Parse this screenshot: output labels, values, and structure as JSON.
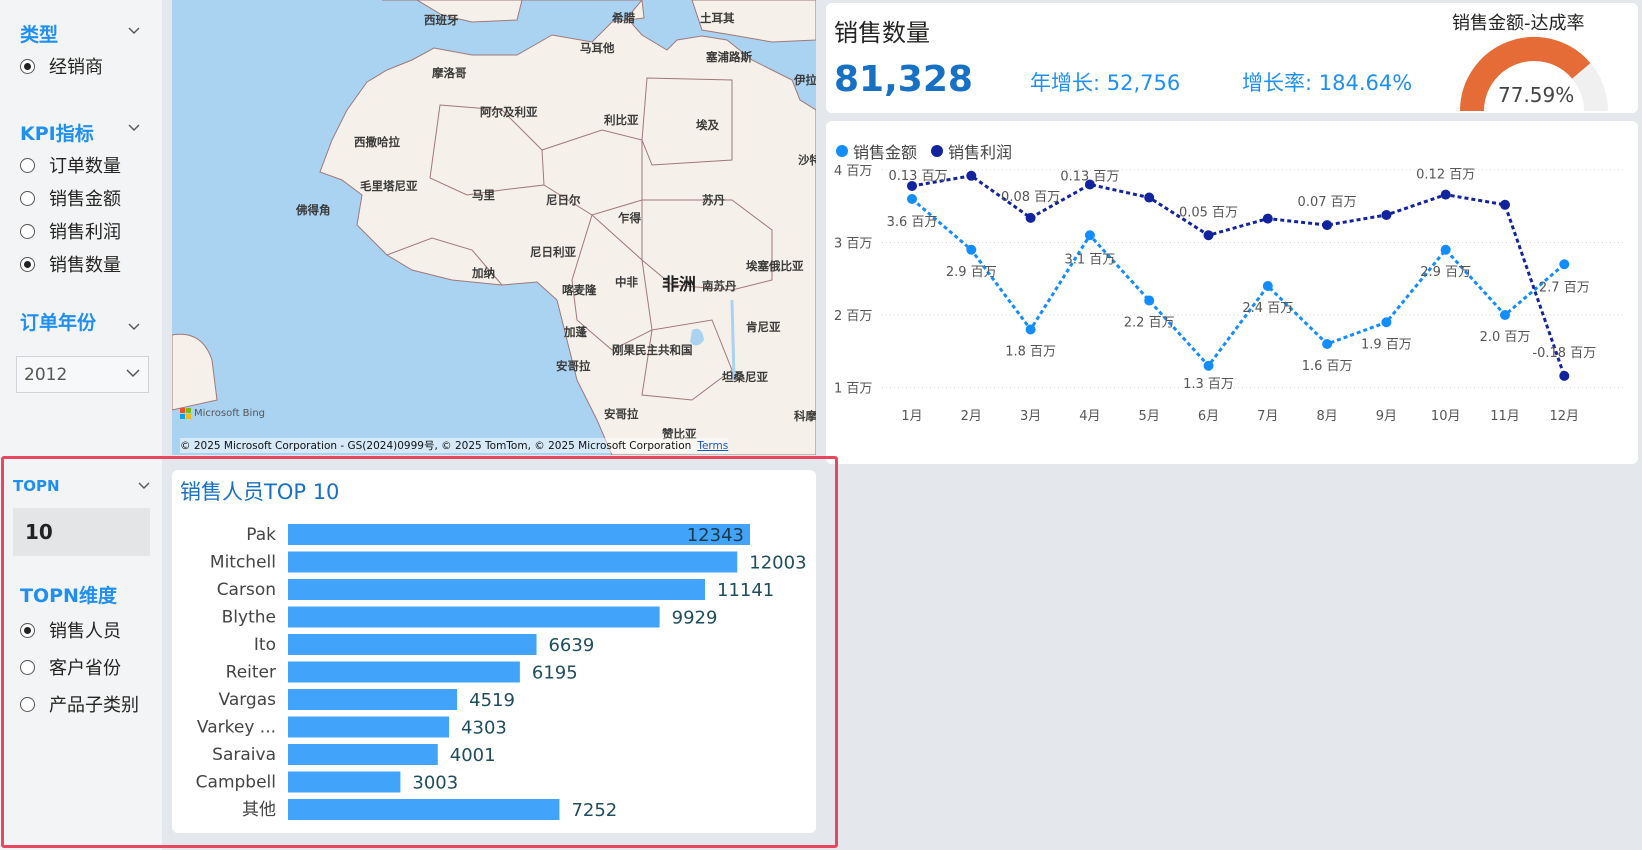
{
  "slicers": {
    "type": {
      "title": "类型",
      "options": [
        {
          "label": "经销商",
          "selected": true
        }
      ]
    },
    "kpi": {
      "title": "KPI指标",
      "options": [
        {
          "label": "订单数量",
          "selected": false
        },
        {
          "label": "销售金额",
          "selected": false
        },
        {
          "label": "销售利润",
          "selected": false
        },
        {
          "label": "销售数量",
          "selected": true
        }
      ]
    },
    "year": {
      "title": "订单年份",
      "value": "2012"
    },
    "topn": {
      "title": "TOPN",
      "value": "10"
    },
    "topn_dim": {
      "title": "TOPN维度",
      "options": [
        {
          "label": "销售人员",
          "selected": true
        },
        {
          "label": "客户省份",
          "selected": false
        },
        {
          "label": "产品子类别",
          "selected": false
        }
      ]
    }
  },
  "map": {
    "labels": [
      "西班牙",
      "希腊",
      "土耳其",
      "马耳他",
      "塞浦路斯",
      "摩洛哥",
      "伊拉",
      "阿尔及利亚",
      "利比亚",
      "埃及",
      "西撒哈拉",
      "沙特",
      "毛里塔尼亚",
      "马里",
      "尼日尔",
      "乍得",
      "苏丹",
      "佛得角",
      "尼日利亚",
      "埃塞俄比亚",
      "加纳",
      "喀麦隆",
      "中非",
      "非洲",
      "南苏丹",
      "加蓬",
      "刚果民主共和国",
      "肯尼亚",
      "安哥拉",
      "坦桑尼亚",
      "安哥拉",
      "赞比亚",
      "科摩"
    ],
    "provider": "Microsoft Bing",
    "copyright": "© 2025 Microsoft Corporation - GS(2024)0999号, © 2025 TomTom, © 2025 Microsoft Corporation",
    "terms": "Terms"
  },
  "kpi": {
    "title": "销售数量",
    "value": "81,328",
    "yoy_growth": "年增长: 52,756",
    "growth_rate": "增长率: 184.64%",
    "gauge_title": "销售金额-达成率",
    "gauge_value": "77.59%",
    "gauge_fraction": 0.7759,
    "colors": {
      "gauge_fill": "#e66c37",
      "gauge_track": "#f0f0f0"
    }
  },
  "line_chart": {
    "legend": [
      "销售金额",
      "销售利润"
    ],
    "colors": {
      "sales": "#118dff",
      "profit": "#12239e"
    }
  },
  "bar_chart": {
    "title": "销售人员TOP 10",
    "color": "#42a3fb"
  },
  "chart_data": [
    {
      "type": "line",
      "title": "",
      "categories": [
        "1月",
        "2月",
        "3月",
        "4月",
        "5月",
        "6月",
        "7月",
        "8月",
        "9月",
        "10月",
        "11月",
        "12月"
      ],
      "yticks": [
        "1 百万",
        "2 百万",
        "3 百万",
        "4 百万"
      ],
      "ylim": [
        0.8,
        4
      ],
      "grid": true,
      "legend_position": "top-left",
      "series": [
        {
          "name": "销售金额",
          "values": [
            3.6,
            2.9,
            1.8,
            3.1,
            2.2,
            1.3,
            2.4,
            1.6,
            1.9,
            2.9,
            2.0,
            2.7
          ],
          "labels": [
            "3.6 百万",
            "2.9 百万",
            "1.8 百万",
            "3.1 百万",
            "2.2 百万",
            "1.3 百万",
            "2.4 百万",
            "1.6 百万",
            "1.9 百万",
            "2.9 百万",
            "2.0 百万",
            "2.7 百万"
          ]
        },
        {
          "name": "销售利润",
          "values": [
            3.78,
            3.92,
            3.34,
            3.8,
            3.62,
            3.1,
            3.33,
            3.24,
            3.38,
            3.66,
            3.52,
            1.16
          ],
          "labels": [
            "0.13 百万",
            "",
            "0.08 百万",
            "0.13 百万",
            "",
            "0.05 百万",
            "",
            "0.07 百万",
            "",
            "0.12 百万",
            "",
            "-0.18 百万"
          ]
        }
      ]
    },
    {
      "type": "bar",
      "title": "销售人员TOP 10",
      "categories": [
        "Pak",
        "Mitchell",
        "Carson",
        "Blythe",
        "Ito",
        "Reiter",
        "Vargas",
        "Varkey ...",
        "Saraiva",
        "Campbell",
        "其他"
      ],
      "values": [
        12343,
        12003,
        11141,
        9929,
        6639,
        6195,
        4519,
        4303,
        4001,
        3003,
        7252
      ],
      "xlim": [
        0,
        12343
      ]
    }
  ]
}
